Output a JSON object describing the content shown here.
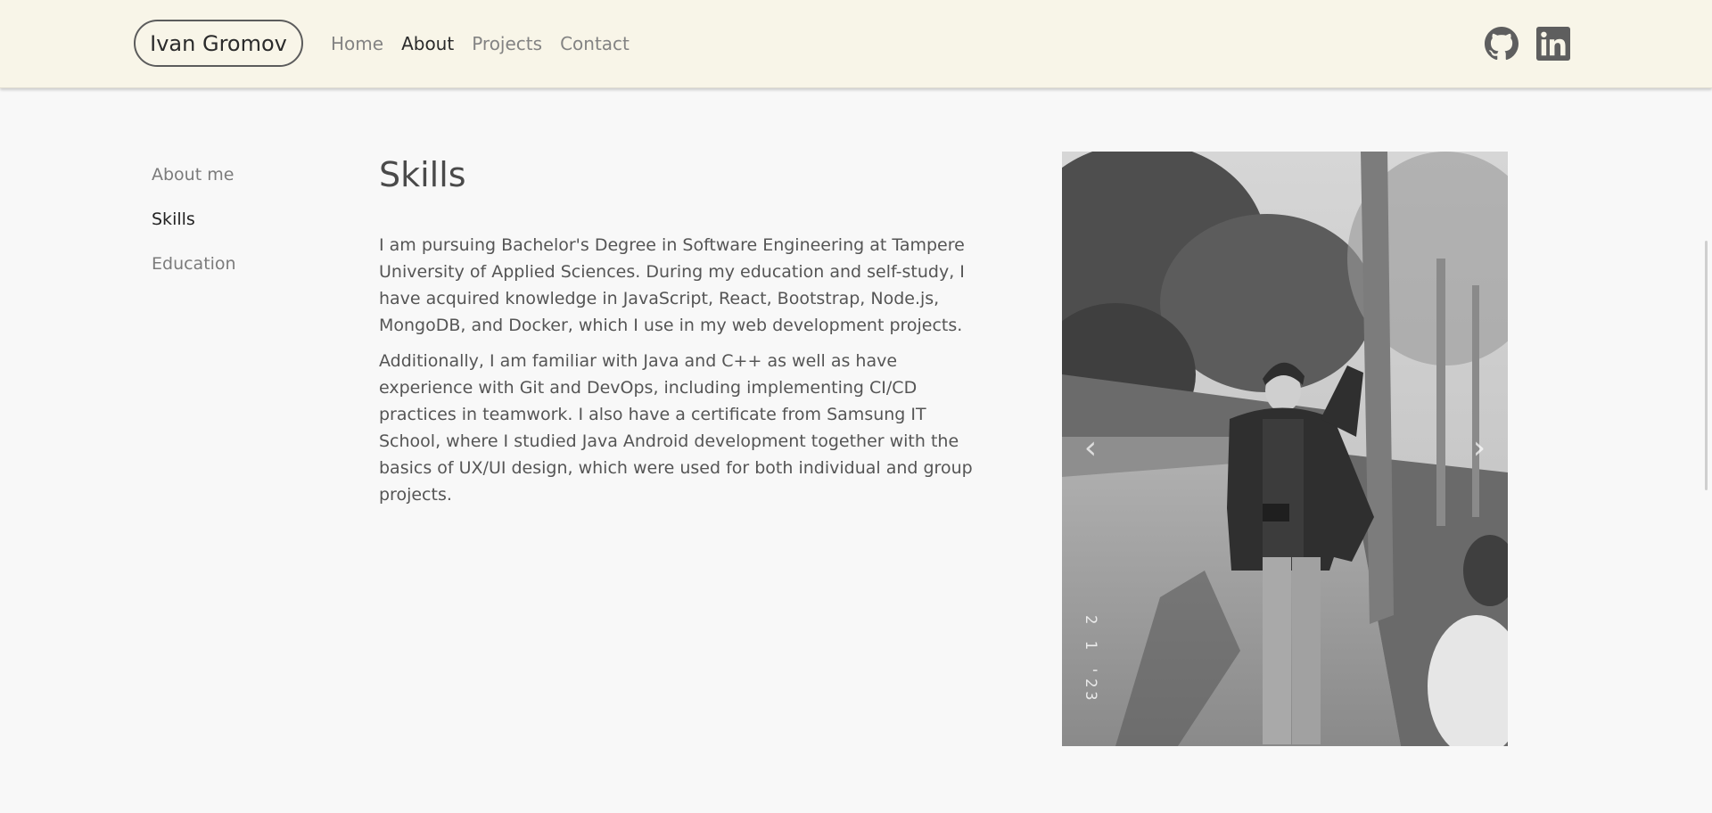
{
  "header": {
    "brand": "Ivan Gromov",
    "nav": [
      {
        "label": "Home",
        "active": false
      },
      {
        "label": "About",
        "active": true
      },
      {
        "label": "Projects",
        "active": false
      },
      {
        "label": "Contact",
        "active": false
      }
    ],
    "social": [
      {
        "icon": "github-icon"
      },
      {
        "icon": "linkedin-icon"
      }
    ]
  },
  "sidebar": {
    "items": [
      {
        "label": "About me",
        "active": false
      },
      {
        "label": "Skills",
        "active": true
      },
      {
        "label": "Education",
        "active": false
      }
    ]
  },
  "main": {
    "title": "Skills",
    "paragraphs": [
      "I am pursuing Bachelor's Degree in Software Engineering at Tampere University of Applied Sciences. During my education and self-study, I have acquired knowledge in JavaScript, React, Bootstrap, Node.js, MongoDB, and Docker, which I use in my web development projects.",
      "Additionally, I am familiar with Java and C++ as well as have experience with Git and DevOps, including implementing CI/CD practices in teamwork. I also have a certificate from Samsung IT School, where I studied Java Android development together with the basics of UX/UI design, which were used for both individual and group projects."
    ]
  },
  "carousel": {
    "prev_icon": "‹",
    "next_icon": "›",
    "photo_date_stamp": "2 1 '23"
  },
  "colors": {
    "navbar_bg": "#f8f5e8",
    "page_bg": "#f8f8f8",
    "text": "#555555",
    "active_text": "#222222",
    "muted_text": "#838383"
  }
}
